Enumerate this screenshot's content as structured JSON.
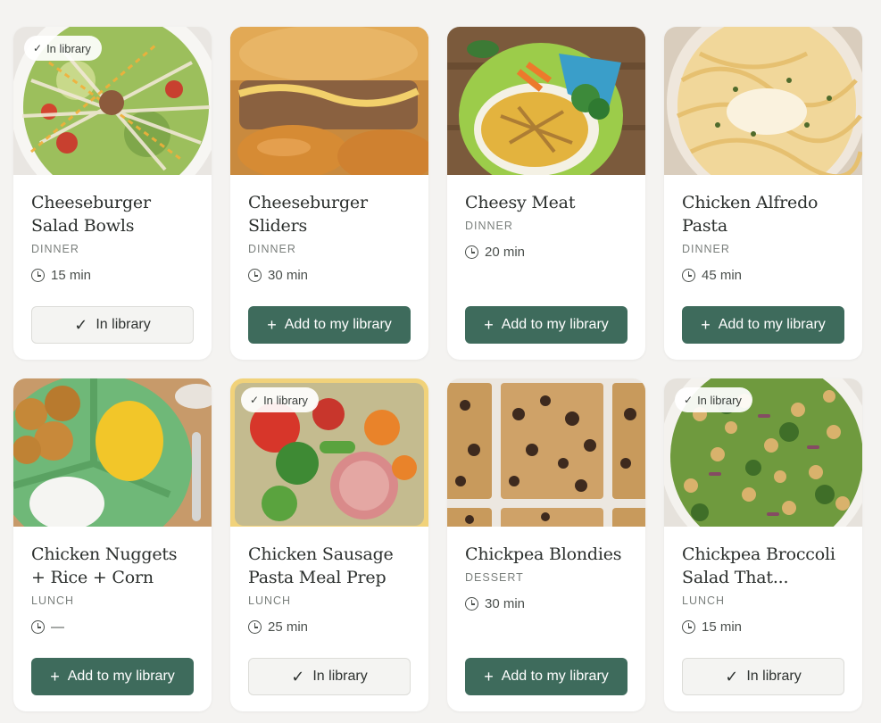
{
  "badge_label": "In library",
  "add_label": "Add to my library",
  "in_library_label": "In library",
  "accent_color": "#3e6b5c",
  "icons": {
    "add": "plus-icon",
    "in_library": "check-icon",
    "time": "clock-icon"
  },
  "recipes": [
    {
      "title": "Cheeseburger Salad Bowls",
      "category": "DINNER",
      "time": "15 min",
      "in_library": true,
      "badge": true,
      "photo": "salad"
    },
    {
      "title": "Cheeseburger Sliders",
      "category": "DINNER",
      "time": "30 min",
      "in_library": false,
      "badge": false,
      "photo": "sliders"
    },
    {
      "title": "Cheesy Meat",
      "category": "DINNER",
      "time": "20 min",
      "in_library": false,
      "badge": false,
      "photo": "pasta-plate"
    },
    {
      "title": "Chicken Alfredo Pasta",
      "category": "DINNER",
      "time": "45 min",
      "in_library": false,
      "badge": false,
      "photo": "alfredo"
    },
    {
      "title": "Chicken Nuggets + Rice + Corn",
      "category": "LUNCH",
      "time": "—",
      "in_library": false,
      "badge": false,
      "photo": "nuggets"
    },
    {
      "title": "Chicken Sausage Pasta Meal Prep",
      "category": "LUNCH",
      "time": "25 min",
      "in_library": true,
      "badge": true,
      "photo": "sausage"
    },
    {
      "title": "Chickpea Blondies",
      "category": "DESSERT",
      "time": "30 min",
      "in_library": false,
      "badge": false,
      "photo": "blondies"
    },
    {
      "title": "Chickpea Broccoli Salad That...",
      "category": "LUNCH",
      "time": "15 min",
      "in_library": true,
      "badge": true,
      "photo": "broccoli"
    }
  ]
}
